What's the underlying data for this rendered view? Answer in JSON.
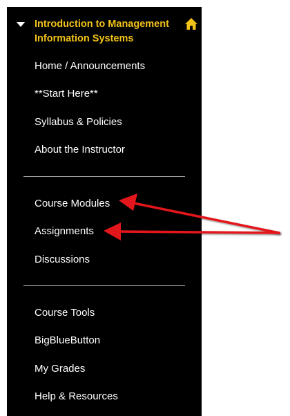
{
  "course": {
    "title": "Introduction to Management\nInformation Systems",
    "home_icon": "home-icon"
  },
  "menu": {
    "group1": [
      "Home / Announcements",
      "**Start Here**",
      "Syllabus & Policies",
      "About the Instructor"
    ],
    "group2": [
      "Course Modules",
      "Assignments",
      "Discussions"
    ],
    "group3": [
      "Course Tools",
      "BigBlueButton",
      "My Grades",
      "Help & Resources"
    ]
  },
  "colors": {
    "menu_background": "#000000",
    "course_title": "#f2c21a",
    "menu_text": "#ffffff",
    "divider": "#a9a9a9",
    "annotation_arrow": "#e3161b"
  },
  "annotations": {
    "arrow_targets": [
      "Course Modules",
      "Assignments"
    ]
  }
}
